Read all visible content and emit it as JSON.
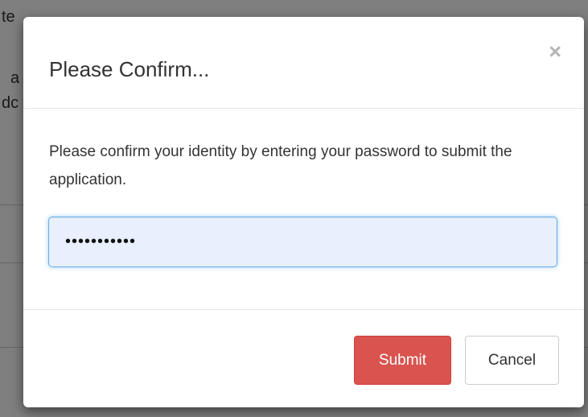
{
  "background": {
    "fragments": [
      "te",
      "a",
      "dc"
    ]
  },
  "modal": {
    "title": "Please Confirm...",
    "close_symbol": "×",
    "message": "Please confirm your identity by entering your password to submit the application.",
    "password": {
      "value": "•••••••••••",
      "type": "password"
    },
    "buttons": {
      "submit": "Submit",
      "cancel": "Cancel"
    },
    "colors": {
      "submit_bg": "#d9534f",
      "input_focus_border": "#66afe9",
      "input_autofill_bg": "#e8f0fe"
    }
  }
}
